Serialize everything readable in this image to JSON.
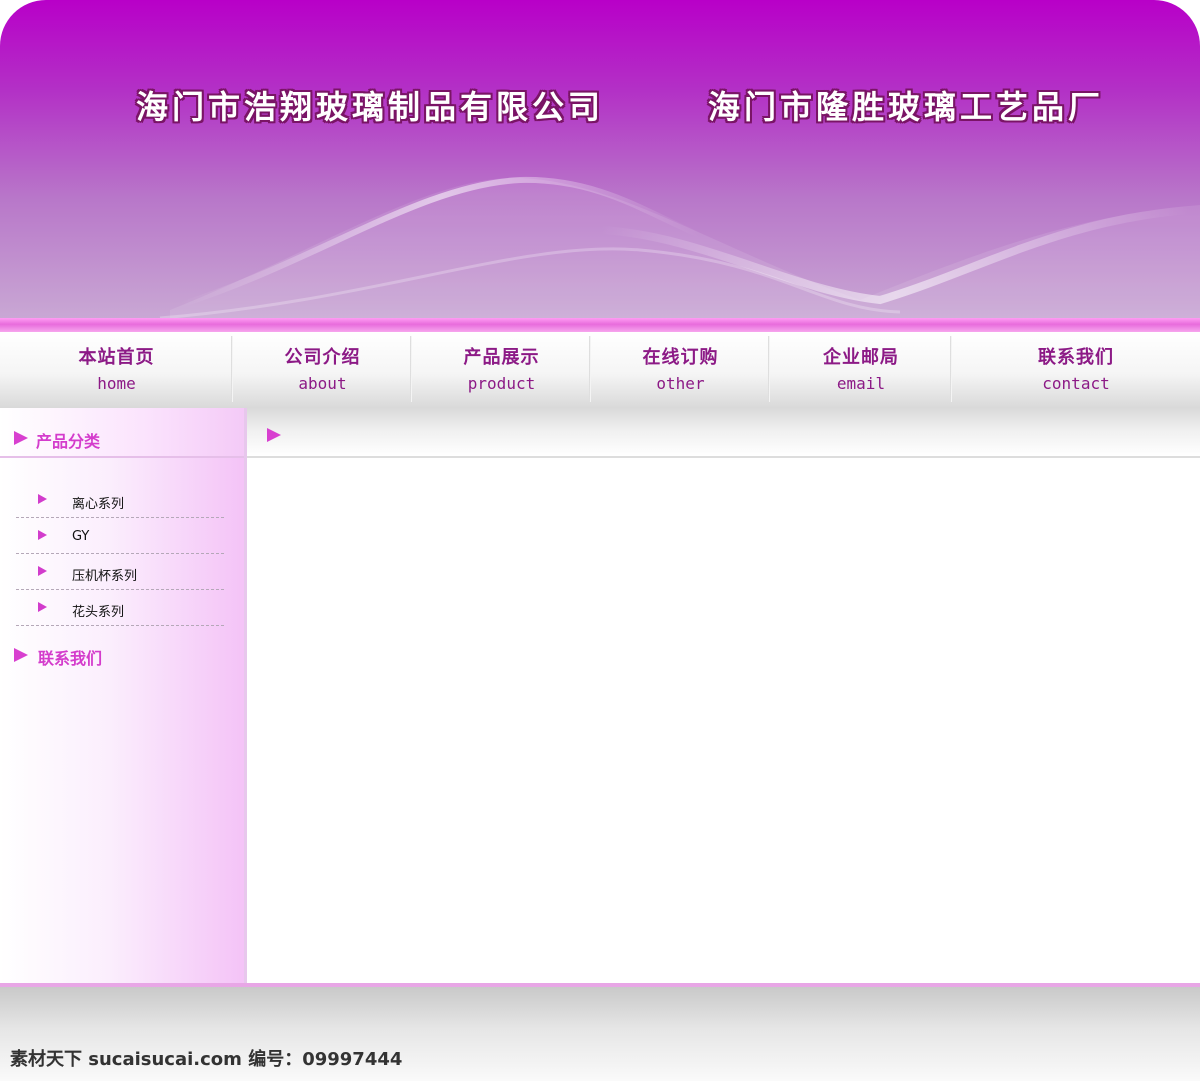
{
  "header": {
    "company_1": "海门市浩翔玻璃制品有限公司",
    "company_2": "海门市隆胜玻璃工艺品厂"
  },
  "nav": [
    {
      "zh": "本站首页",
      "en": "home"
    },
    {
      "zh": "公司介绍",
      "en": "about"
    },
    {
      "zh": "产品展示",
      "en": "product"
    },
    {
      "zh": "在线订购",
      "en": "other"
    },
    {
      "zh": "企业邮局",
      "en": "email"
    },
    {
      "zh": "联系我们",
      "en": "contact"
    }
  ],
  "sidebar": {
    "product_heading": "产品分类",
    "categories": [
      "离心系列",
      "GY",
      "压机杯系列",
      "花头系列"
    ],
    "contact_heading": "联系我们"
  },
  "main": {
    "heading": ""
  },
  "footer": {
    "watermark": "素材天下 sucaisucai.com  编号：09997444"
  },
  "colors": {
    "brand_purple": "#b800c8",
    "nav_text": "#8c1a86",
    "accent_pink": "#d43ccc"
  }
}
